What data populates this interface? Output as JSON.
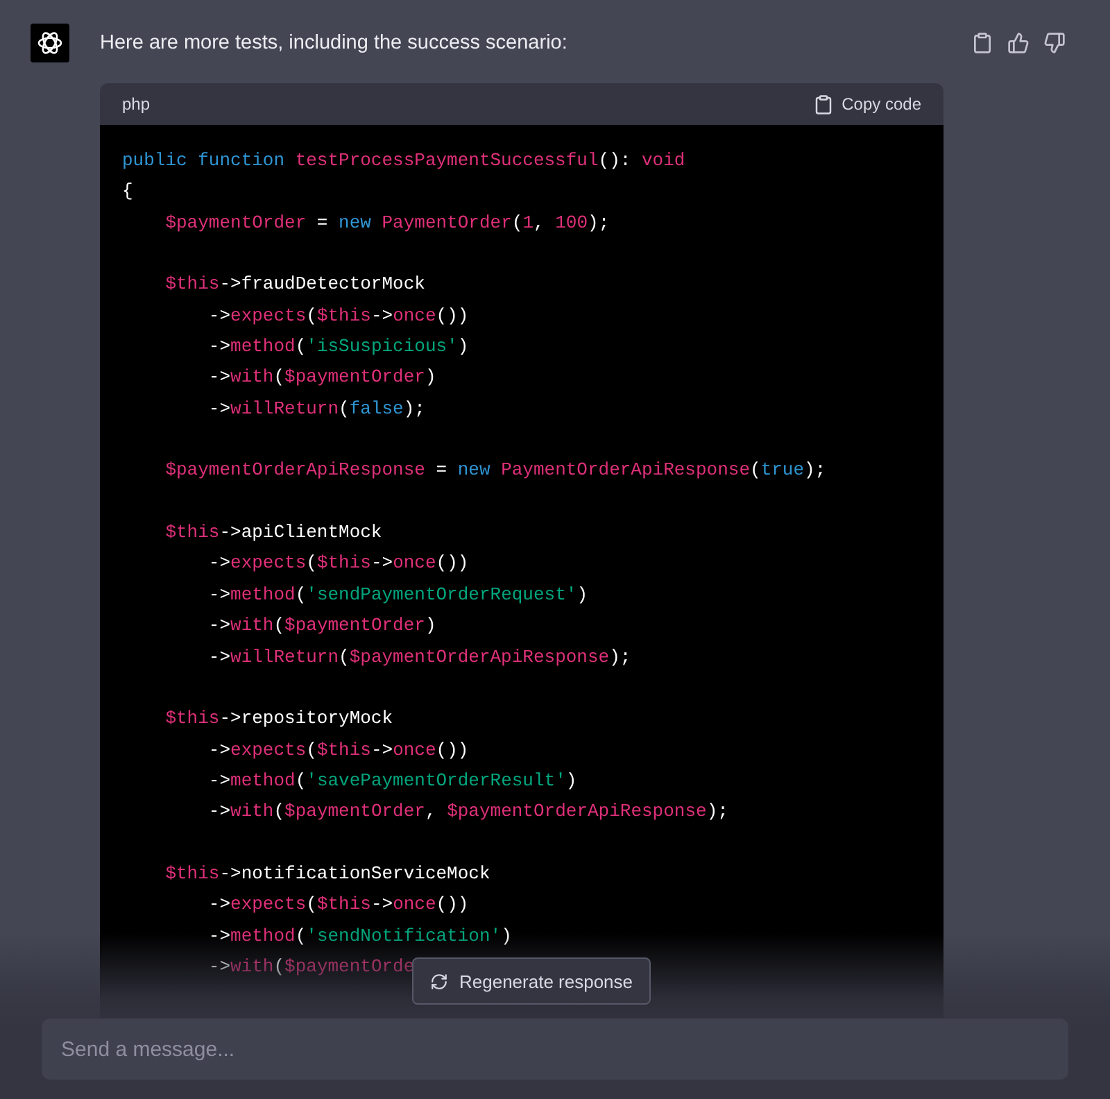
{
  "message": {
    "text": "Here are more tests, including the success scenario:"
  },
  "code_block": {
    "language": "php",
    "copy_label": "Copy code",
    "blocks": [
      {
        "lines": [
          {
            "tokens": [
              {
                "kind": "keyword",
                "text": "public function "
              },
              {
                "kind": "name",
                "text": "testProcessPaymentSuccessful"
              },
              {
                "kind": "plain",
                "text": "(): "
              },
              {
                "kind": "name",
                "text": "void"
              }
            ]
          },
          {
            "tokens": [
              {
                "kind": "plain",
                "text": "{"
              }
            ]
          },
          {
            "tokens": [
              {
                "kind": "name",
                "text": "    $paymentOrder"
              },
              {
                "kind": "plain",
                "text": " = "
              },
              {
                "kind": "keyword",
                "text": "new "
              },
              {
                "kind": "name",
                "text": "PaymentOrder"
              },
              {
                "kind": "plain",
                "text": "("
              },
              {
                "kind": "name",
                "text": "1"
              },
              {
                "kind": "plain",
                "text": ", "
              },
              {
                "kind": "name",
                "text": "100"
              },
              {
                "kind": "plain",
                "text": ");"
              }
            ]
          }
        ]
      },
      {
        "lines": [
          {
            "tokens": [
              {
                "kind": "name",
                "text": "    $this"
              },
              {
                "kind": "plain",
                "text": "->fraudDetectorMock"
              }
            ]
          },
          {
            "tokens": [
              {
                "kind": "plain",
                "text": "        ->"
              },
              {
                "kind": "name",
                "text": "expects"
              },
              {
                "kind": "plain",
                "text": "("
              },
              {
                "kind": "name",
                "text": "$this"
              },
              {
                "kind": "plain",
                "text": "->"
              },
              {
                "kind": "name",
                "text": "once"
              },
              {
                "kind": "plain",
                "text": "())"
              }
            ]
          },
          {
            "tokens": [
              {
                "kind": "plain",
                "text": "        ->"
              },
              {
                "kind": "name",
                "text": "method"
              },
              {
                "kind": "plain",
                "text": "("
              },
              {
                "kind": "string",
                "text": "'isSuspicious'"
              },
              {
                "kind": "plain",
                "text": ")"
              }
            ]
          },
          {
            "tokens": [
              {
                "kind": "plain",
                "text": "        ->"
              },
              {
                "kind": "name",
                "text": "with"
              },
              {
                "kind": "plain",
                "text": "("
              },
              {
                "kind": "name",
                "text": "$paymentOrder"
              },
              {
                "kind": "plain",
                "text": ")"
              }
            ]
          },
          {
            "tokens": [
              {
                "kind": "plain",
                "text": "        ->"
              },
              {
                "kind": "name",
                "text": "willReturn"
              },
              {
                "kind": "plain",
                "text": "("
              },
              {
                "kind": "keyword",
                "text": "false"
              },
              {
                "kind": "plain",
                "text": ");"
              }
            ]
          }
        ]
      },
      {
        "lines": [
          {
            "tokens": [
              {
                "kind": "name",
                "text": "    $paymentOrderApiResponse"
              },
              {
                "kind": "plain",
                "text": " = "
              },
              {
                "kind": "keyword",
                "text": "new "
              },
              {
                "kind": "name",
                "text": "PaymentOrderApiResponse"
              },
              {
                "kind": "plain",
                "text": "("
              },
              {
                "kind": "keyword",
                "text": "true"
              },
              {
                "kind": "plain",
                "text": ");"
              }
            ]
          }
        ]
      },
      {
        "lines": [
          {
            "tokens": [
              {
                "kind": "name",
                "text": "    $this"
              },
              {
                "kind": "plain",
                "text": "->apiClientMock"
              }
            ]
          },
          {
            "tokens": [
              {
                "kind": "plain",
                "text": "        ->"
              },
              {
                "kind": "name",
                "text": "expects"
              },
              {
                "kind": "plain",
                "text": "("
              },
              {
                "kind": "name",
                "text": "$this"
              },
              {
                "kind": "plain",
                "text": "->"
              },
              {
                "kind": "name",
                "text": "once"
              },
              {
                "kind": "plain",
                "text": "())"
              }
            ]
          },
          {
            "tokens": [
              {
                "kind": "plain",
                "text": "        ->"
              },
              {
                "kind": "name",
                "text": "method"
              },
              {
                "kind": "plain",
                "text": "("
              },
              {
                "kind": "string",
                "text": "'sendPaymentOrderRequest'"
              },
              {
                "kind": "plain",
                "text": ")"
              }
            ]
          },
          {
            "tokens": [
              {
                "kind": "plain",
                "text": "        ->"
              },
              {
                "kind": "name",
                "text": "with"
              },
              {
                "kind": "plain",
                "text": "("
              },
              {
                "kind": "name",
                "text": "$paymentOrder"
              },
              {
                "kind": "plain",
                "text": ")"
              }
            ]
          },
          {
            "tokens": [
              {
                "kind": "plain",
                "text": "        ->"
              },
              {
                "kind": "name",
                "text": "willReturn"
              },
              {
                "kind": "plain",
                "text": "("
              },
              {
                "kind": "name",
                "text": "$paymentOrderApiResponse"
              },
              {
                "kind": "plain",
                "text": ");"
              }
            ]
          }
        ]
      },
      {
        "lines": [
          {
            "tokens": [
              {
                "kind": "name",
                "text": "    $this"
              },
              {
                "kind": "plain",
                "text": "->repositoryMock"
              }
            ]
          },
          {
            "tokens": [
              {
                "kind": "plain",
                "text": "        ->"
              },
              {
                "kind": "name",
                "text": "expects"
              },
              {
                "kind": "plain",
                "text": "("
              },
              {
                "kind": "name",
                "text": "$this"
              },
              {
                "kind": "plain",
                "text": "->"
              },
              {
                "kind": "name",
                "text": "once"
              },
              {
                "kind": "plain",
                "text": "())"
              }
            ]
          },
          {
            "tokens": [
              {
                "kind": "plain",
                "text": "        ->"
              },
              {
                "kind": "name",
                "text": "method"
              },
              {
                "kind": "plain",
                "text": "("
              },
              {
                "kind": "string",
                "text": "'savePaymentOrderResult'"
              },
              {
                "kind": "plain",
                "text": ")"
              }
            ]
          },
          {
            "tokens": [
              {
                "kind": "plain",
                "text": "        ->"
              },
              {
                "kind": "name",
                "text": "with"
              },
              {
                "kind": "plain",
                "text": "("
              },
              {
                "kind": "name",
                "text": "$paymentOrder"
              },
              {
                "kind": "plain",
                "text": ", "
              },
              {
                "kind": "name",
                "text": "$paymentOrderApiResponse"
              },
              {
                "kind": "plain",
                "text": ");"
              }
            ]
          }
        ]
      },
      {
        "lines": [
          {
            "tokens": [
              {
                "kind": "name",
                "text": "    $this"
              },
              {
                "kind": "plain",
                "text": "->notificationServiceMock"
              }
            ]
          },
          {
            "tokens": [
              {
                "kind": "plain",
                "text": "        ->"
              },
              {
                "kind": "name",
                "text": "expects"
              },
              {
                "kind": "plain",
                "text": "("
              },
              {
                "kind": "name",
                "text": "$this"
              },
              {
                "kind": "plain",
                "text": "->"
              },
              {
                "kind": "name",
                "text": "once"
              },
              {
                "kind": "plain",
                "text": "())"
              }
            ]
          },
          {
            "tokens": [
              {
                "kind": "plain",
                "text": "        ->"
              },
              {
                "kind": "name",
                "text": "method"
              },
              {
                "kind": "plain",
                "text": "("
              },
              {
                "kind": "string",
                "text": "'sendNotification'"
              },
              {
                "kind": "plain",
                "text": ")"
              }
            ]
          },
          {
            "tokens": [
              {
                "kind": "plain",
                "text": "        ->"
              },
              {
                "kind": "name",
                "text": "with"
              },
              {
                "kind": "plain",
                "text": "("
              },
              {
                "kind": "name",
                "text": "$paymentOrde"
              }
            ]
          }
        ]
      }
    ]
  },
  "regenerate_button": {
    "label": "Regenerate response"
  },
  "composer": {
    "placeholder": "Send a message..."
  }
}
